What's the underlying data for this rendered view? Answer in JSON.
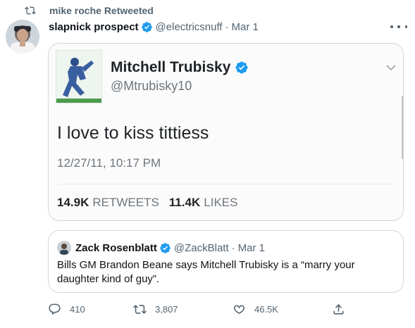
{
  "retweet_context": {
    "label": "mike roche Retweeted"
  },
  "tweet": {
    "author_name": "slapnick prospect",
    "author_handle": "@electricsnuff",
    "dot": "·",
    "date": "Mar 1",
    "more_icon": "more-icon",
    "verified_icon": "verified-badge-icon"
  },
  "embedded_screenshot": {
    "name": "Mitchell Trubisky",
    "handle": "@Mtrubisky10",
    "text": "I love to kiss tittiess",
    "timestamp": "12/27/11, 10:17 PM",
    "retweets_count": "14.9K",
    "retweets_label": "RETWEETS",
    "likes_count": "11.4K",
    "likes_label": "LIKES"
  },
  "quoted_tweet": {
    "author_name": "Zack Rosenblatt",
    "author_handle": "@ZackBlatt",
    "dot": "·",
    "date": "Mar 1",
    "text": "Bills GM Brandon Beane says Mitchell Trubisky is a “marry your daughter kind of guy”."
  },
  "actions": {
    "reply_count": "410",
    "retweet_count": "3,807",
    "like_count": "46.5K"
  },
  "colors": {
    "verified_blue": "#1d9bf0",
    "secondary_text": "#536471",
    "border": "#cfd9de"
  }
}
